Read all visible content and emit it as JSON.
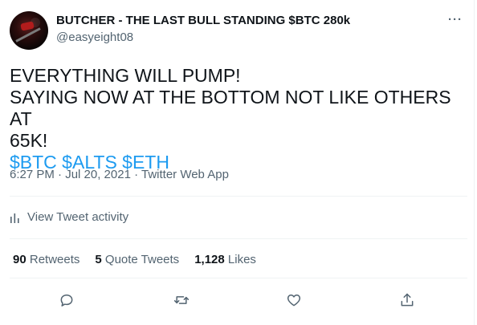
{
  "author": {
    "name": "BUTCHER - THE LAST BULL STANDING $BTC 280k",
    "handle": "@easyeight08"
  },
  "more_label": "···",
  "tweet": {
    "lines": [
      "EVERYTHING WILL PUMP!",
      "SAYING NOW AT THE BOTTOM NOT LIKE OTHERS AT",
      "65K!"
    ],
    "hashtags": "$BTC $ALTS $ETH"
  },
  "meta": "6:27 PM · Jul 20, 2021 · Twitter Web App",
  "activity_label": "View Tweet activity",
  "stats": {
    "retweets_count": "90",
    "retweets_label": "Retweets",
    "quotes_count": "5",
    "quotes_label": "Quote Tweets",
    "likes_count": "1,128",
    "likes_label": "Likes"
  },
  "colors": {
    "accent": "#1d9bf0",
    "secondary_text": "#536471",
    "primary_text": "#0f1419"
  },
  "icons": {
    "reply": "reply-icon",
    "retweet": "retweet-icon",
    "like": "like-icon",
    "share": "share-icon",
    "activity": "activity-icon"
  }
}
